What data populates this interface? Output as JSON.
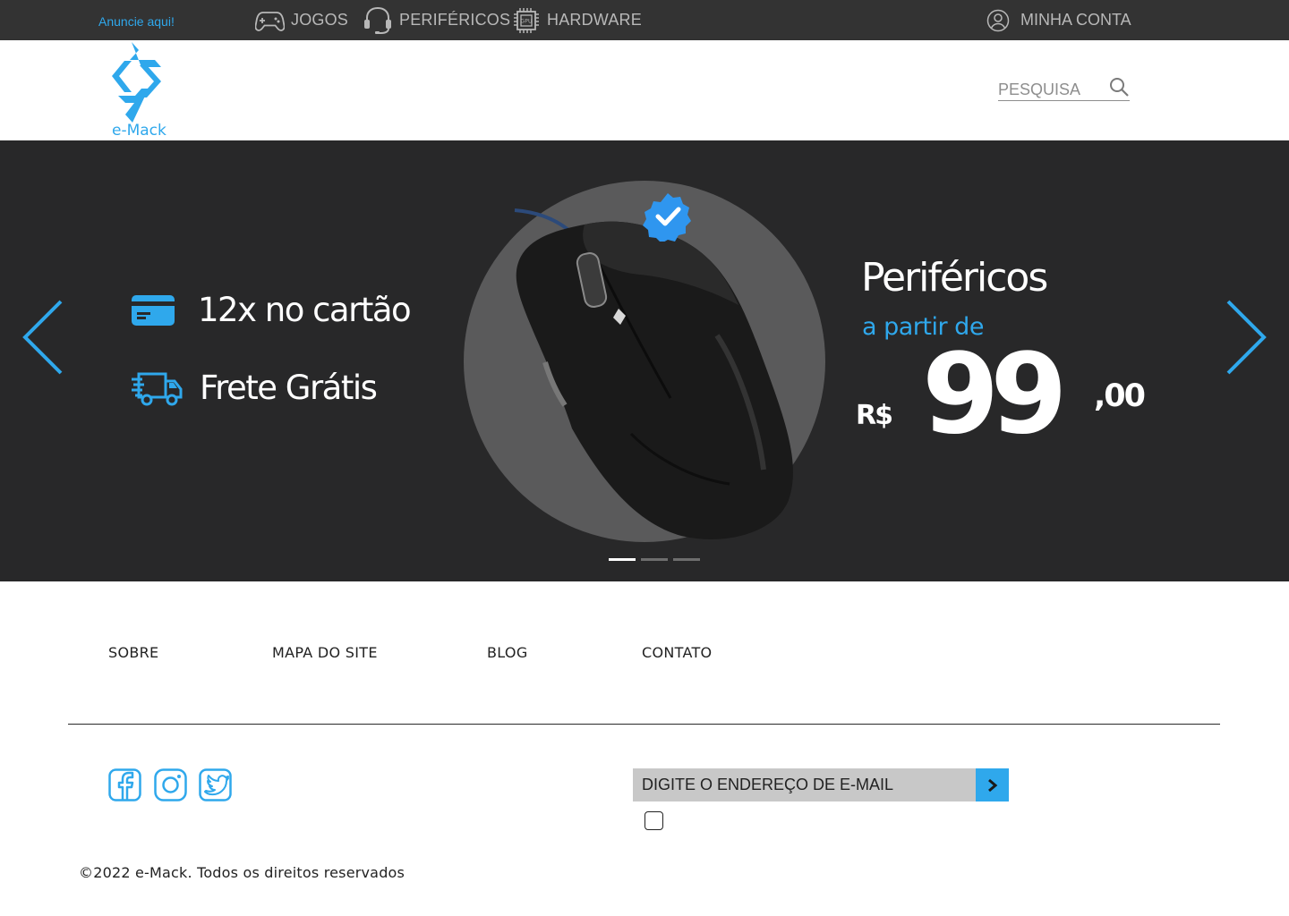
{
  "topbar": {
    "ad_link": "Anuncie aqui!",
    "categories": [
      {
        "label": "JOGOS",
        "icon": "gamepad-icon"
      },
      {
        "label": "PERIFÉRICOS",
        "icon": "headset-icon"
      },
      {
        "label": "HARDWARE",
        "icon": "gpu-chip-icon"
      }
    ],
    "account": {
      "label": "MINHA CONTA",
      "icon": "user-circle-icon"
    }
  },
  "header": {
    "logo_text": "e-Mack",
    "search": {
      "placeholder": "PESQUISA",
      "value": "",
      "icon": "search-icon"
    }
  },
  "hero": {
    "features": [
      {
        "label": "12x no cartão",
        "icon": "credit-card-icon"
      },
      {
        "label": "Frete Grátis",
        "icon": "delivery-truck-icon"
      }
    ],
    "title": "Periféricos",
    "subtitle": "a partir de",
    "price": {
      "currency": "R$",
      "integer": "99",
      "decimal": ",00"
    },
    "product": {
      "icon": "computer-mouse-image",
      "badge": "verified-badge-icon"
    },
    "carousel": {
      "slides": 3,
      "active": 0
    }
  },
  "footer": {
    "links": [
      "SOBRE",
      "MAPA DO SITE",
      "BLOG",
      "CONTATO"
    ],
    "social": [
      "facebook-icon",
      "instagram-icon",
      "twitter-icon"
    ],
    "newsletter": {
      "placeholder": "DIGITE O ENDEREÇO DE E-MAIL",
      "value": ""
    },
    "copyright": "©2022 e-Mack. Todos os direitos reservados"
  },
  "colors": {
    "accent": "#2fa8ec",
    "topbar_bg": "#333333",
    "hero_bg": "#282829",
    "circle": "#5a5a5b",
    "newsletter_bg": "#c8c8c8"
  }
}
